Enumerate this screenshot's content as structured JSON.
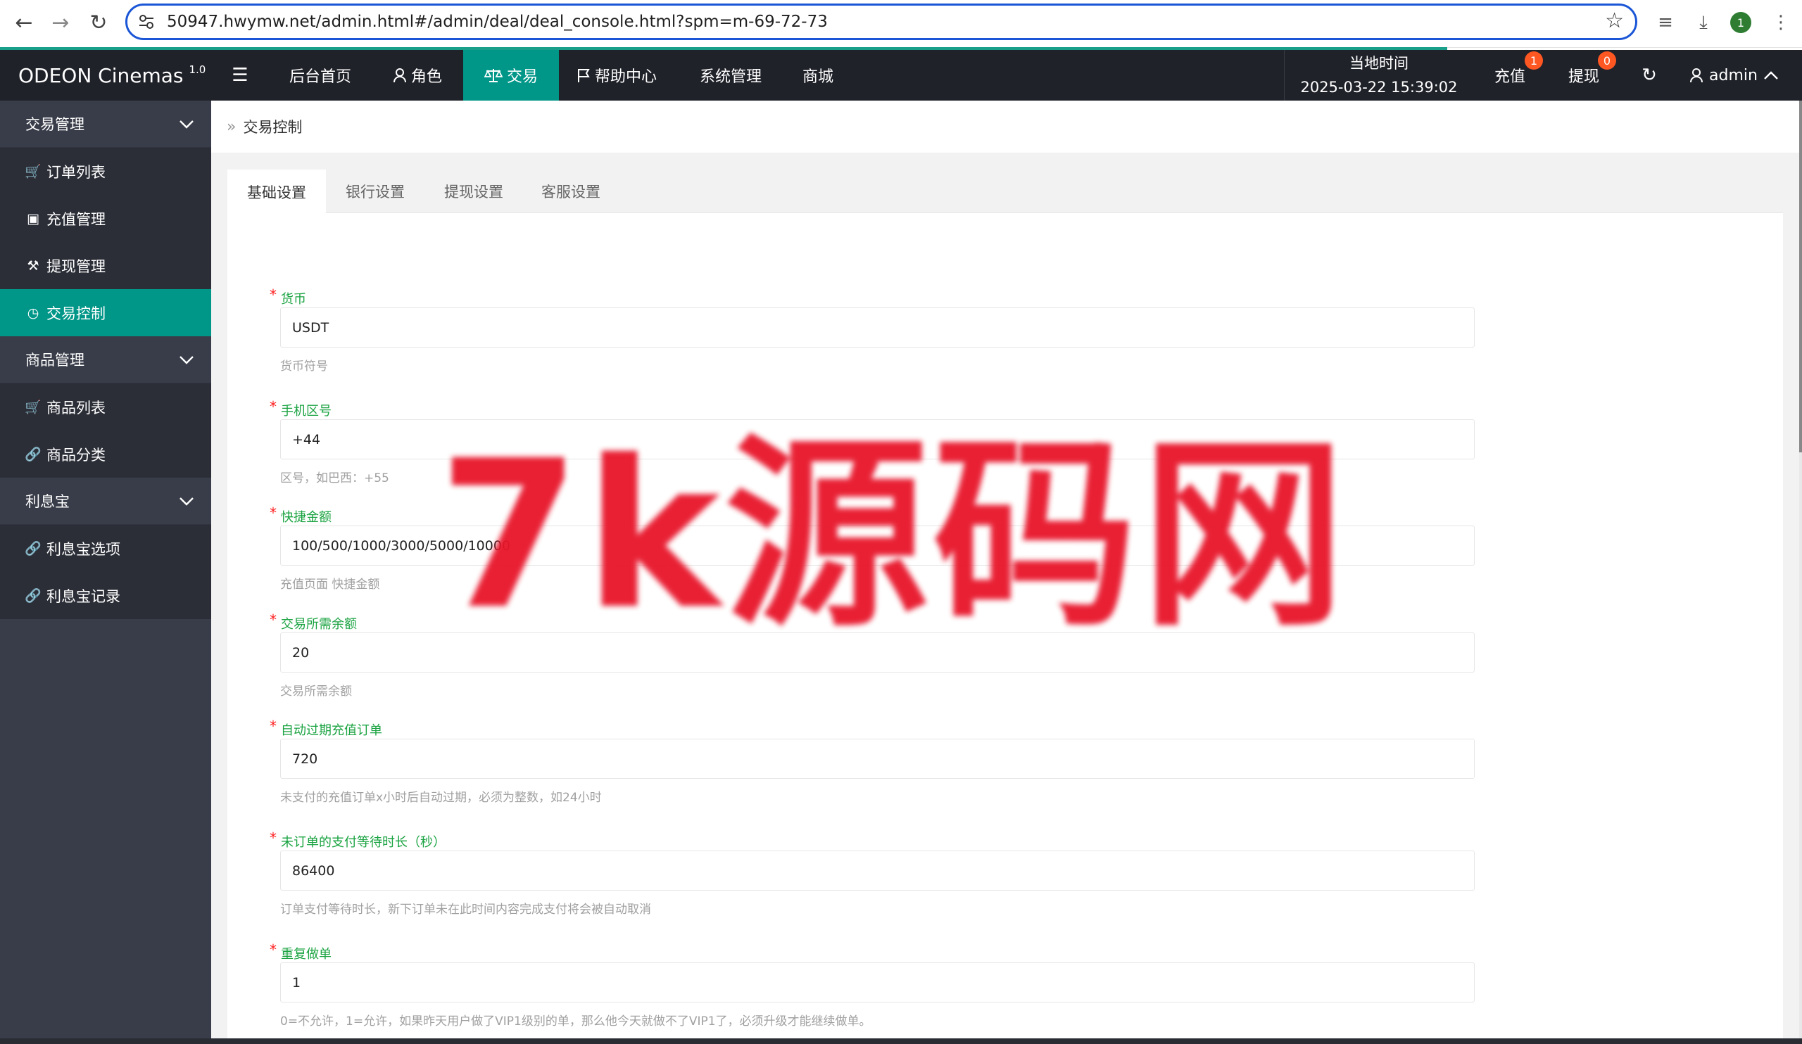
{
  "browser": {
    "url": "50947.hwymw.net/admin.html#/admin/deal/deal_console.html?spm=m-69-72-73",
    "profile_initial": "1"
  },
  "header": {
    "brand": "ODEON Cinemas",
    "version": "1.0",
    "nav": [
      {
        "label": "后台首页",
        "icon": ""
      },
      {
        "label": "角色",
        "icon": "user-icon"
      },
      {
        "label": "交易",
        "icon": "scale-icon"
      },
      {
        "label": "帮助中心",
        "icon": "flag-icon"
      },
      {
        "label": "系统管理",
        "icon": ""
      },
      {
        "label": "商城",
        "icon": ""
      }
    ],
    "local_time_label": "当地时间",
    "local_time_value": "2025-03-22 15:39:02",
    "recharge_label": "充值",
    "recharge_badge": "1",
    "withdraw_label": "提现",
    "withdraw_badge": "0",
    "user": "admin"
  },
  "sidebar": {
    "groups": [
      {
        "label": "交易管理",
        "items": [
          {
            "label": "订单列表",
            "icon": "cart-icon"
          },
          {
            "label": "充值管理",
            "icon": "chat-icon"
          },
          {
            "label": "提现管理",
            "icon": "gavel-icon"
          },
          {
            "label": "交易控制",
            "icon": "dashboard-icon",
            "active": true
          }
        ]
      },
      {
        "label": "商品管理",
        "items": [
          {
            "label": "商品列表",
            "icon": "cart-icon"
          },
          {
            "label": "商品分类",
            "icon": "link-icon"
          }
        ]
      },
      {
        "label": "利息宝",
        "items": [
          {
            "label": "利息宝选项",
            "icon": "link-icon"
          },
          {
            "label": "利息宝记录",
            "icon": "link-icon"
          }
        ]
      }
    ]
  },
  "breadcrumb": "交易控制",
  "tabs": [
    "基础设置",
    "银行设置",
    "提现设置",
    "客服设置"
  ],
  "form": {
    "fields": [
      {
        "label": "货币",
        "value": "USDT",
        "help": "货币符号"
      },
      {
        "label": "手机区号",
        "value": "+44",
        "help": "区号，如巴西：+55"
      },
      {
        "label": "快捷金额",
        "value": "100/500/1000/3000/5000/10000",
        "help": "充值页面 快捷金额"
      },
      {
        "label": "交易所需余额",
        "value": "20",
        "help": "交易所需余额"
      },
      {
        "label": "自动过期充值订单",
        "value": "720",
        "help": "未支付的充值订单x小时后自动过期，必须为整数，如24小时"
      },
      {
        "label": "未订单的支付等待时长（秒）",
        "value": "86400",
        "help": "订单支付等待时长，新下订单未在此时间内容完成支付将会被自动取消"
      },
      {
        "label": "重复做单",
        "value": "1",
        "help": "0=不允许，1=允许，如果昨天用户做了VIP1级别的单，那么他今天就做不了VIP1了，必须升级才能继续做单。"
      }
    ]
  },
  "watermark": "7k源码网",
  "colors": {
    "accent": "#009688",
    "header_bg": "#20222a",
    "sidebar_bg": "#393d49",
    "sidebar_item_bg": "#2b2e37",
    "badge": "#ff5722",
    "label_green": "#1aa341",
    "required": "#ff1e1e",
    "watermark": "#e8152a"
  }
}
